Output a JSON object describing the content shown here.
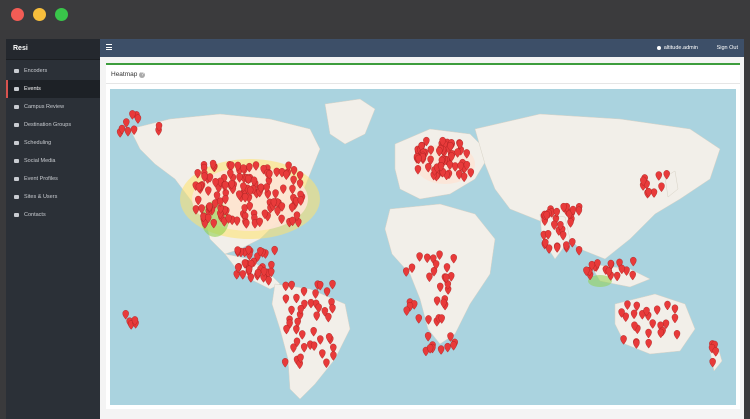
{
  "window": {
    "controls": [
      "close",
      "minimize",
      "maximize"
    ]
  },
  "sidebar": {
    "brand": "Resi",
    "items": [
      {
        "label": "Encoders",
        "icon": "gear-icon",
        "active": false
      },
      {
        "label": "Events",
        "icon": "folder-icon",
        "active": true
      },
      {
        "label": "Campus Review",
        "icon": "video-icon",
        "active": false
      },
      {
        "label": "Destination Groups",
        "icon": "folder-icon",
        "active": false
      },
      {
        "label": "Scheduling",
        "icon": "calendar-icon",
        "active": false
      },
      {
        "label": "Social Media",
        "icon": "share-icon",
        "active": false
      },
      {
        "label": "Event Profiles",
        "icon": "file-icon",
        "active": false
      },
      {
        "label": "Sites & Users",
        "icon": "list-icon",
        "active": false
      },
      {
        "label": "Contacts",
        "icon": "list-icon",
        "active": false
      }
    ]
  },
  "topbar": {
    "menu_icon": "hamburger-icon",
    "username": "altitude.admin",
    "signout": "Sign Out"
  },
  "panel": {
    "title": "Heatmap",
    "help_icon": "question-icon"
  },
  "colors": {
    "sidebar_bg": "#2b3037",
    "topbar_bg": "#3d4f68",
    "accent": "#d9534f",
    "panel_border": "#3d9d3d",
    "ocean": "#aad3df",
    "land": "#f2efe9",
    "marker": "#e83a3a"
  }
}
